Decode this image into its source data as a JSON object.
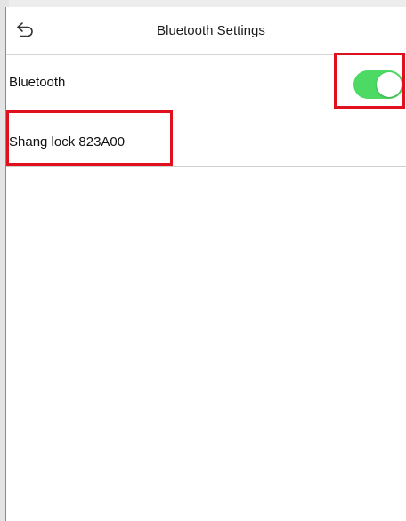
{
  "header": {
    "title": "Bluetooth Settings",
    "back_icon": "back-arrow-icon"
  },
  "settings": {
    "bluetooth_label": "Bluetooth",
    "bluetooth_enabled": true
  },
  "devices": [
    {
      "name": "Shang lock 823A00"
    }
  ],
  "colors": {
    "toggle_on": "#4cd964",
    "highlight_box": "#e0101c"
  }
}
